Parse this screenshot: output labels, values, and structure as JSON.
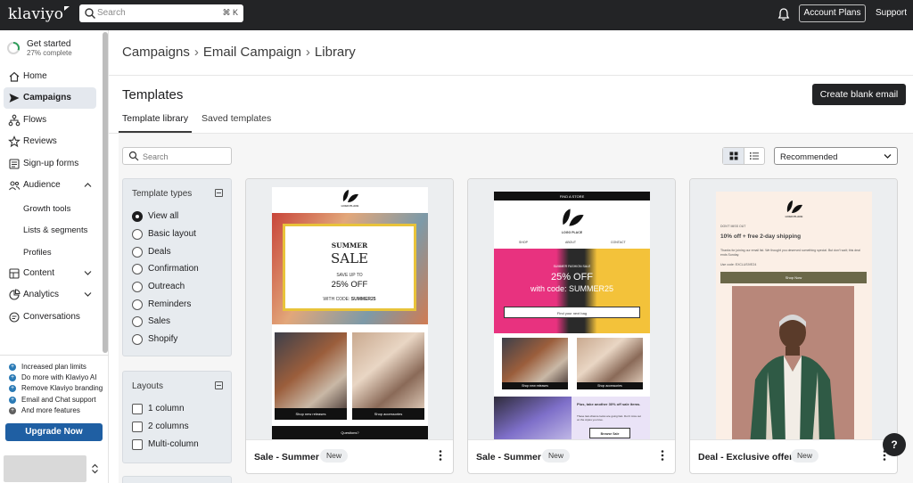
{
  "topbar": {
    "logo": "klaviyo",
    "search_placeholder": "Search",
    "search_shortcut": "⌘ K",
    "account_plans": "Account Plans",
    "support": "Support"
  },
  "sidebar": {
    "get_started": {
      "title": "Get started",
      "progress_text": "27% complete",
      "progress": 0.27
    },
    "items": [
      {
        "label": "Home",
        "icon": "home-icon"
      },
      {
        "label": "Campaigns",
        "icon": "send-icon",
        "active": true
      },
      {
        "label": "Flows",
        "icon": "flow-icon"
      },
      {
        "label": "Reviews",
        "icon": "star-icon"
      },
      {
        "label": "Sign-up forms",
        "icon": "form-icon"
      },
      {
        "label": "Audience",
        "icon": "people-icon",
        "expanded": true
      },
      {
        "label": "Content",
        "icon": "content-icon"
      },
      {
        "label": "Analytics",
        "icon": "analytics-icon"
      },
      {
        "label": "Conversations",
        "icon": "chat-icon"
      }
    ],
    "audience_sub": [
      "Growth tools",
      "Lists & segments",
      "Profiles"
    ],
    "features": [
      "Increased plan limits",
      "Do more with Klaviyo AI",
      "Remove Klaviyo branding",
      "Email and Chat support",
      "And more features"
    ],
    "upgrade": "Upgrade Now"
  },
  "breadcrumb": [
    "Campaigns",
    "Email Campaign",
    "Library"
  ],
  "page_title": "Templates",
  "create_button": "Create blank email",
  "tabs": [
    "Template library",
    "Saved templates"
  ],
  "library": {
    "search_placeholder": "Search",
    "sort_value": "Recommended"
  },
  "filters": {
    "template_types": {
      "title": "Template types",
      "options": [
        "View all",
        "Basic layout",
        "Deals",
        "Confirmation",
        "Outreach",
        "Reminders",
        "Sales",
        "Shopify"
      ],
      "selected": "View all"
    },
    "layouts": {
      "title": "Layouts",
      "options": [
        "1 column",
        "2 columns",
        "Multi-column"
      ]
    }
  },
  "cards": [
    {
      "name": "Sale - Summer",
      "badge": "New",
      "preview": {
        "logo": "LOGO PLACE",
        "headline_top": "SUMMER",
        "headline": "SALE",
        "save": "SAVE UP TO",
        "discount": "25% OFF",
        "code_label": "WITH CODE:",
        "code": "SUMMER25",
        "btn1": "Shop new releases",
        "btn2": "Shop accessories",
        "footer": "Questions?"
      }
    },
    {
      "name": "Sale - Summer",
      "badge": "New",
      "preview": {
        "store": "FIND A STORE",
        "logo": "LOGO PLACE",
        "nav": [
          "SHOP",
          "ABOUT",
          "CONTACT"
        ],
        "promo_small": "SUMMER FASHION SALE",
        "discount": "25% OFF",
        "code_line": "with code: SUMMER25",
        "cta": "Find your next bag",
        "btn1": "Shop new releases",
        "btn2": "Shop accessories",
        "extra_title": "Plus, take another 30% off sale items.",
        "extra_body": "These last-chance looks are going fast. Don't miss out on the styles you love.",
        "extra_cta": "Browse Sale"
      }
    },
    {
      "name": "Deal - Exclusive offer",
      "badge": "New",
      "preview": {
        "logo": "LOGO PLACE",
        "eyebrow": "DON'T MISS OUT",
        "headline": "10% off + free 2-day shipping",
        "body": "Thanks for joining our email list. We thought you deserved something special. But don't wait; this deal ends Sunday.",
        "code_line": "Use code: EXCLUSIVE24",
        "cta": "Shop Now"
      }
    }
  ],
  "help": "?",
  "colors": {
    "topbar": "#232426",
    "accent_blue": "#1f5fa3",
    "active_nav": "#e4e8ee"
  }
}
